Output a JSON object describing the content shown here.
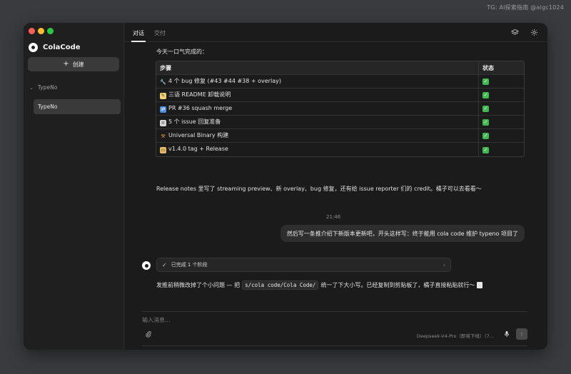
{
  "watermark": "TG: AI探索指南 @aigc1024",
  "sidebar": {
    "brand": "ColaCode",
    "new_button": "创建",
    "group": "TypeNo",
    "session": "TypeNo"
  },
  "tabs": [
    {
      "label": "对话",
      "active": true
    },
    {
      "label": "交付",
      "active": false
    }
  ],
  "top_icons": [
    "layers-icon",
    "gear-icon"
  ],
  "conversation": {
    "intro": "今天一口气完成的：",
    "table": {
      "headers": [
        "步骤",
        "状态"
      ],
      "rows": [
        {
          "icon": "wrench-icon",
          "step": "4 个 bug 修复 (#43 #44 #38 + overlay)",
          "status": "check-icon"
        },
        {
          "icon": "memo-icon",
          "step": "三语 README 卸载说明",
          "status": "check-icon"
        },
        {
          "icon": "merge-icon",
          "step": "PR #36 squash merge",
          "status": "check-icon"
        },
        {
          "icon": "clipboard-icon",
          "step": "5 个 issue 回复准备",
          "status": "check-icon"
        },
        {
          "icon": "construction-icon",
          "step": "Universal Binary 构建",
          "status": "check-icon"
        },
        {
          "icon": "ticket-icon",
          "step": "v1.4.0 tag + Release",
          "status": "check-icon"
        }
      ]
    },
    "release_note": "Release notes 里写了 streaming preview、新 overlay、bug 修复，还有给 issue reporter 们的 credit。橘子可以去看看～",
    "timestamp": "21:46",
    "user_message": "然后写一条推介绍下新版本更新吧，开头这样写：终于能用 cola code 维护 typeno 项目了",
    "steps_done": "已完成 1 个阶段",
    "fix_text_before": "发推前稍微改掉了个小问题 — 把",
    "fix_code": "s/cola code/Cola Code/",
    "fix_text_after": "统一了下大小写。已经复制到剪贴板了，橘子直接粘贴就行～"
  },
  "composer": {
    "placeholder": "输入消息...",
    "model": "Deepseek-V4-Pro（即将下线）（7..."
  },
  "colors": {
    "window_bg": "#1b1b1b",
    "sidebar_bg": "#1f1f1f",
    "check_green": "#3fb950"
  }
}
